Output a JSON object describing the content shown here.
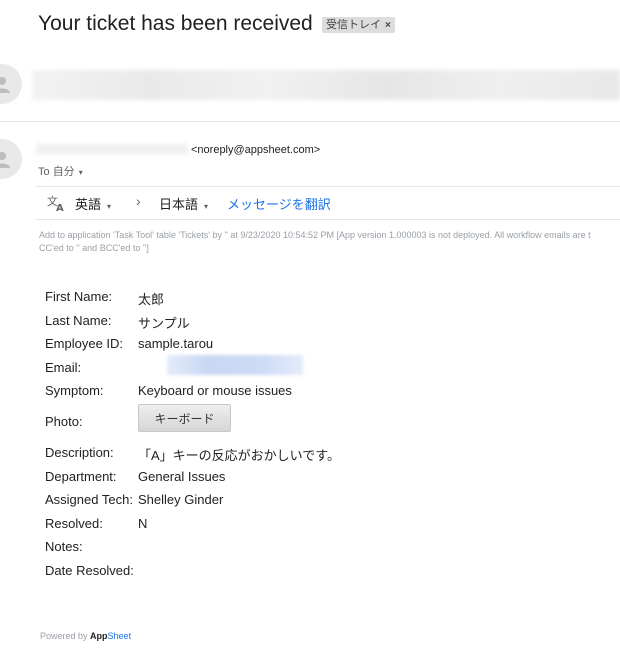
{
  "email": {
    "subject": "Your ticket has been received",
    "label": "受信トレイ",
    "label_close": "×",
    "sender_address": "<noreply@appsheet.com>",
    "to_prefix": "To",
    "to_name": "自分",
    "caret": "▾"
  },
  "translate": {
    "icon": "translate-icon",
    "from_lang": "英語",
    "arrow": "›",
    "to_lang": "日本語",
    "action_link": "メッセージを翻訳"
  },
  "meta": {
    "line1": "Add to application 'Task Tool' table 'Tickets' by '' at 9/23/2020 10:54:52 PM [App version 1.000003 is not deployed. All workflow emails are t",
    "line2": "CC'ed to '' and BCC'ed to '']"
  },
  "fields": {
    "first_name_label": "First Name:",
    "first_name_value": "太郎",
    "last_name_label": "Last Name:",
    "last_name_value": "サンプル",
    "employee_id_label": "Employee ID:",
    "employee_id_value": "sample.tarou",
    "email_label": "Email:",
    "symptom_label": "Symptom:",
    "symptom_value": "Keyboard or mouse issues",
    "photo_label": "Photo:",
    "photo_value": "キーボード",
    "description_label": "Description:",
    "description_value": "「A」キーの反応がおかしいです。",
    "department_label": "Department:",
    "department_value": "General Issues",
    "assigned_label": "Assigned Tech:",
    "assigned_value": "Shelley Ginder",
    "resolved_label": "Resolved:",
    "resolved_value": "N",
    "notes_label": "Notes:",
    "date_resolved_label": "Date Resolved:"
  },
  "footer": {
    "powered_by": "Powered by",
    "brand_app": "App",
    "brand_sheet": "Sheet"
  }
}
